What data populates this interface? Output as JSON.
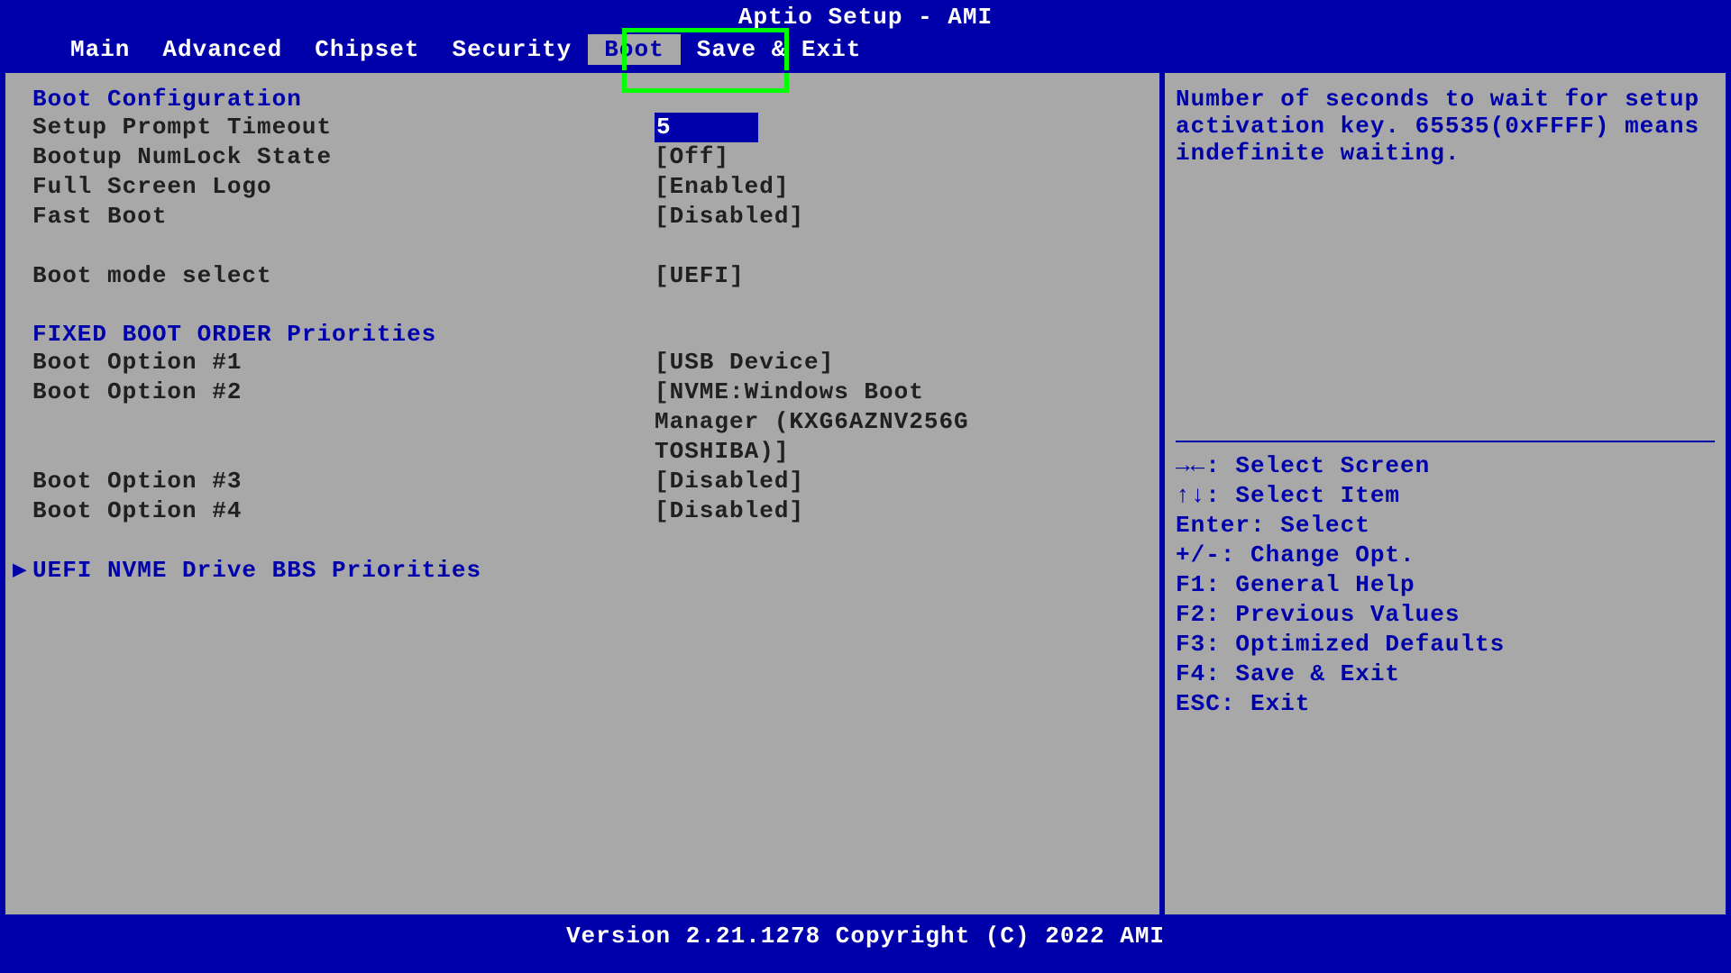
{
  "header": {
    "title": "Aptio Setup - AMI"
  },
  "menu": {
    "items": [
      {
        "label": "Main",
        "active": false
      },
      {
        "label": "Advanced",
        "active": false
      },
      {
        "label": "Chipset",
        "active": false
      },
      {
        "label": "Security",
        "active": false
      },
      {
        "label": "Boot",
        "active": true
      },
      {
        "label": "Save & Exit",
        "active": false
      }
    ]
  },
  "boot": {
    "section_title": "Boot Configuration",
    "setup_prompt_label": "Setup Prompt Timeout",
    "setup_prompt_value": "5",
    "numlock_label": "Bootup NumLock State",
    "numlock_value": "[Off]",
    "fullscreen_label": "Full Screen Logo",
    "fullscreen_value": "[Enabled]",
    "fastboot_label": "Fast Boot",
    "fastboot_value": "[Disabled]",
    "bootmode_label": "Boot mode select",
    "bootmode_value": "[UEFI]",
    "priorities_title": "FIXED BOOT ORDER Priorities",
    "opt1_label": "Boot Option #1",
    "opt1_value": "[USB Device]",
    "opt2_label": "Boot Option #2",
    "opt2_value": "[NVME:Windows Boot Manager (KXG6AZNV256G TOSHIBA)]",
    "opt3_label": "Boot Option #3",
    "opt3_value": "[Disabled]",
    "opt4_label": "Boot Option #4",
    "opt4_value": "[Disabled]",
    "submenu": "UEFI NVME Drive BBS Priorities"
  },
  "help": {
    "description": "Number of seconds to wait for setup activation key. 65535(0xFFFF) means indefinite waiting.",
    "nav": {
      "select_screen": "→←: Select Screen",
      "select_item": "↑↓: Select Item",
      "enter": "Enter: Select",
      "change": "+/-: Change Opt.",
      "f1": "F1: General Help",
      "f2": "F2: Previous Values",
      "f3": "F3: Optimized Defaults",
      "f4": "F4: Save & Exit",
      "esc": "ESC: Exit"
    }
  },
  "footer": {
    "version": "Version 2.21.1278 Copyright (C) 2022 AMI"
  }
}
